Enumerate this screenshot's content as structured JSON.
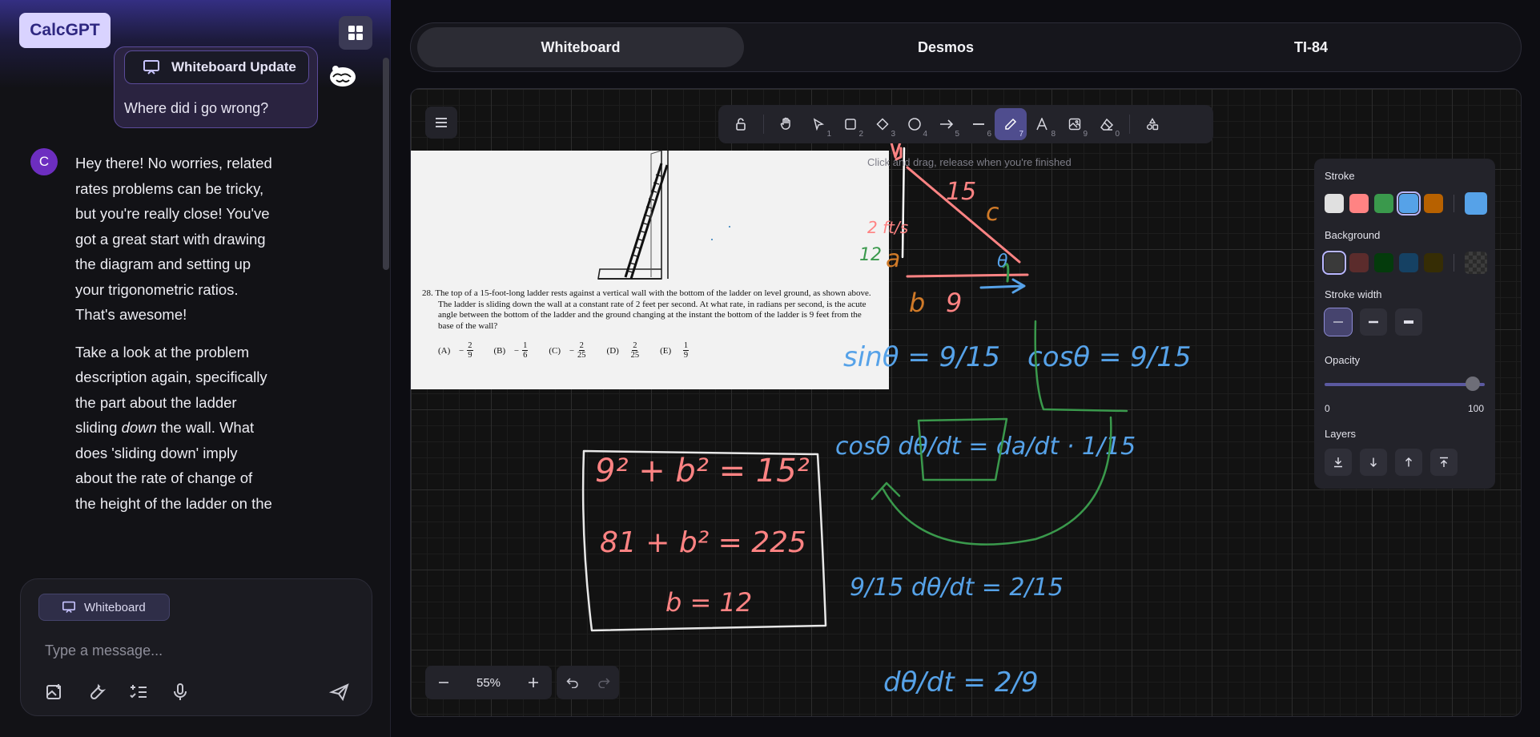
{
  "app": {
    "brand": "CalcGPT"
  },
  "chat": {
    "user_message": {
      "attachment_label": "Whiteboard Update",
      "text": "Where did i go wrong?"
    },
    "assistant_avatar_letter": "C",
    "assistant_paragraphs": [
      "Hey there! No worries, related rates problems can be tricky, but you're really close! You've got a great start with drawing the diagram and setting up your trigonometric ratios. That's awesome!",
      "Take a look at the problem description again, specifically the part about the ladder sliding",
      "down",
      "the wall. What does 'sliding down' imply about the rate of change of the height of the ladder on the"
    ],
    "composer": {
      "chip_label": "Whiteboard",
      "placeholder": "Type a message..."
    }
  },
  "tabs": [
    "Whiteboard",
    "Desmos",
    "TI-84"
  ],
  "active_tab": "Whiteboard",
  "whiteboard": {
    "toolbar_keys": [
      "1",
      "2",
      "3",
      "4",
      "5",
      "6",
      "7",
      "8",
      "9",
      "0"
    ],
    "active_tool": "pencil",
    "hint": "Click and drag, release when you're finished",
    "zoom": "55%",
    "problem": {
      "number": "28.",
      "text": "The top of a 15-foot-long ladder rests against a vertical wall with the bottom of the ladder on level ground, as shown above. The ladder is sliding down the wall at a constant rate of 2 feet per second. At what rate, in radians per second, is the acute angle between the bottom of the ladder and the ground changing at the instant the bottom of the ladder is 9 feet from the base of the wall?",
      "choices": [
        {
          "label": "(A)",
          "sign": "−",
          "num": "2",
          "den": "9"
        },
        {
          "label": "(B)",
          "sign": "−",
          "num": "1",
          "den": "6"
        },
        {
          "label": "(C)",
          "sign": "−",
          "num": "2",
          "den": "25"
        },
        {
          "label": "(D)",
          "sign": "",
          "num": "2",
          "den": "25"
        },
        {
          "label": "(E)",
          "sign": "",
          "num": "1",
          "den": "9"
        }
      ]
    },
    "properties": {
      "stroke_label": "Stroke",
      "background_label": "Background",
      "stroke_width_label": "Stroke width",
      "opacity_label": "Opacity",
      "opacity_min": "0",
      "opacity_max": "100",
      "opacity_value": 100,
      "layers_label": "Layers",
      "stroke_colors": [
        "#e0e0e0",
        "#ff8383",
        "#3a994c",
        "#56a2e8",
        "#b76100"
      ],
      "stroke_selected": "#56a2e8",
      "stroke_current": "#56a2e8",
      "background_colors": [
        "#3a3a3a",
        "#5b2c2c",
        "#043b0c",
        "#154163",
        "#362d05"
      ]
    },
    "handwriting": {
      "diagram_labels": {
        "side_15": "15",
        "c": "c",
        "rate": "2 ft/s",
        "a_value": "12",
        "a": "a",
        "b": "b",
        "b_value": "9",
        "theta": "θ"
      },
      "sin_eq": "sinθ = 9/15",
      "cos_eq": "cosθ = 9/15",
      "deriv_eq": "cosθ dθ/dt = da/dt · 1/15",
      "box_lines": [
        "9² + b² = 15²",
        "81 + b² = 225",
        "b = 12"
      ],
      "step_eq": "9/15 dθ/dt = 2/15",
      "final_eq": "dθ/dt = 2/9"
    }
  }
}
